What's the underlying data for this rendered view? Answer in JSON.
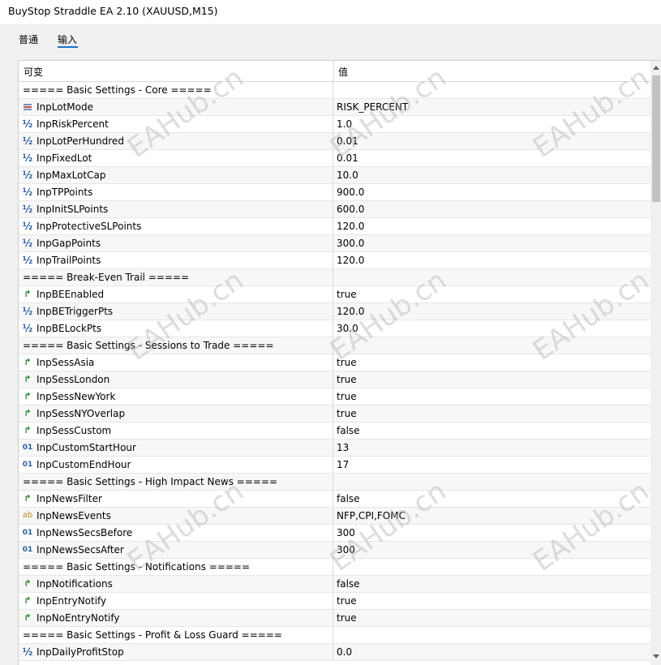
{
  "window": {
    "title": "BuyStop Straddle EA 2.10 (XAUUSD,M15)"
  },
  "tabs": [
    {
      "label": "普通"
    },
    {
      "label": "输入"
    }
  ],
  "grid": {
    "columns": [
      "可变",
      "值"
    ],
    "rows": [
      {
        "type": "section",
        "label": "===== Basic Settings - Core =====",
        "value": ""
      },
      {
        "type": "enum",
        "icon": "enum-icon",
        "label": "InpLotMode",
        "value": "RISK_PERCENT"
      },
      {
        "type": "double",
        "icon": "fraction-icon",
        "label": "InpRiskPercent",
        "value": "1.0"
      },
      {
        "type": "double",
        "icon": "fraction-icon",
        "label": "InpLotPerHundred",
        "value": "0.01"
      },
      {
        "type": "double",
        "icon": "fraction-icon",
        "label": "InpFixedLot",
        "value": "0.01"
      },
      {
        "type": "double",
        "icon": "fraction-icon",
        "label": "InpMaxLotCap",
        "value": "10.0"
      },
      {
        "type": "double",
        "icon": "fraction-icon",
        "label": "InpTPPoints",
        "value": "900.0"
      },
      {
        "type": "double",
        "icon": "fraction-icon",
        "label": "InpInitSLPoints",
        "value": "600.0"
      },
      {
        "type": "double",
        "icon": "fraction-icon",
        "label": "InpProtectiveSLPoints",
        "value": "120.0"
      },
      {
        "type": "double",
        "icon": "fraction-icon",
        "label": "InpGapPoints",
        "value": "300.0"
      },
      {
        "type": "double",
        "icon": "fraction-icon",
        "label": "InpTrailPoints",
        "value": "120.0"
      },
      {
        "type": "section",
        "label": "===== Break-Even Trail =====",
        "value": ""
      },
      {
        "type": "bool",
        "icon": "flag-icon",
        "label": "InpBEEnabled",
        "value": "true"
      },
      {
        "type": "double",
        "icon": "fraction-icon",
        "label": "InpBETriggerPts",
        "value": "120.0"
      },
      {
        "type": "double",
        "icon": "fraction-icon",
        "label": "InpBELockPts",
        "value": "30.0"
      },
      {
        "type": "section",
        "label": "===== Basic Settings - Sessions to Trade =====",
        "value": ""
      },
      {
        "type": "bool",
        "icon": "flag-icon",
        "label": "InpSessAsia",
        "value": "true"
      },
      {
        "type": "bool",
        "icon": "flag-icon",
        "label": "InpSessLondon",
        "value": "true"
      },
      {
        "type": "bool",
        "icon": "flag-icon",
        "label": "InpSessNewYork",
        "value": "true"
      },
      {
        "type": "bool",
        "icon": "flag-icon",
        "label": "InpSessNYOverlap",
        "value": "true"
      },
      {
        "type": "bool",
        "icon": "flag-icon",
        "label": "InpSessCustom",
        "value": "false"
      },
      {
        "type": "int",
        "icon": "integer-icon",
        "label": "InpCustomStartHour",
        "value": "13"
      },
      {
        "type": "int",
        "icon": "integer-icon",
        "label": "InpCustomEndHour",
        "value": "17"
      },
      {
        "type": "section",
        "label": "===== Basic Settings - High Impact News =====",
        "value": ""
      },
      {
        "type": "bool",
        "icon": "flag-icon",
        "label": "InpNewsFilter",
        "value": "false"
      },
      {
        "type": "string",
        "icon": "string-icon",
        "label": "InpNewsEvents",
        "value": "NFP,CPI,FOMC"
      },
      {
        "type": "int",
        "icon": "integer-icon",
        "label": "InpNewsSecsBefore",
        "value": "300"
      },
      {
        "type": "int",
        "icon": "integer-icon",
        "label": "InpNewsSecsAfter",
        "value": "300"
      },
      {
        "type": "section",
        "label": "===== Basic Settings - Notifications =====",
        "value": ""
      },
      {
        "type": "bool",
        "icon": "flag-icon",
        "label": "InpNotifications",
        "value": "false"
      },
      {
        "type": "bool",
        "icon": "flag-icon",
        "label": "InpEntryNotify",
        "value": "true"
      },
      {
        "type": "bool",
        "icon": "flag-icon",
        "label": "InpNoEntryNotify",
        "value": "true"
      },
      {
        "type": "section",
        "label": "===== Basic Settings - Profit & Loss Guard =====",
        "value": ""
      },
      {
        "type": "double",
        "icon": "fraction-icon",
        "label": "InpDailyProfitStop",
        "value": "0.0"
      }
    ]
  },
  "watermark": {
    "text": "EAHub.cn",
    "color": "#b4b4b4"
  },
  "colors": {
    "accent": "#1a73c8",
    "bool_icon": "#2e8b35",
    "number_icon": "#2a5d9e",
    "string_icon": "#b88a2a"
  }
}
